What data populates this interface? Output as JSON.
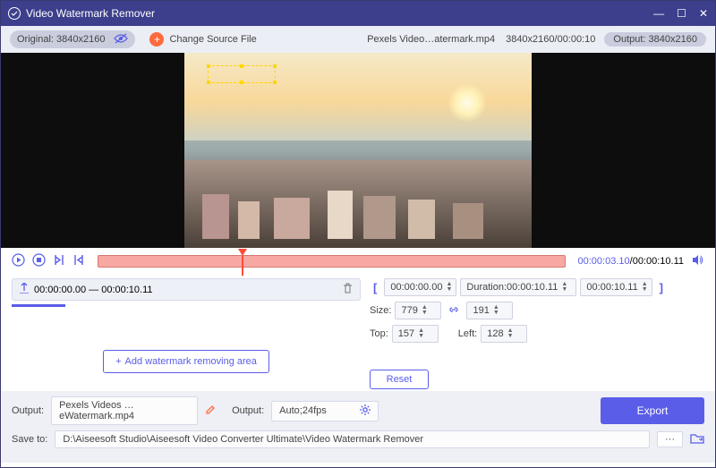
{
  "titlebar": {
    "title": "Video Watermark Remover"
  },
  "toolbar": {
    "original_label": "Original:",
    "original_res": "3840x2160",
    "change_source": "Change Source File",
    "filename": "Pexels Video…atermark.mp4",
    "file_meta": "3840x2160/00:00:10",
    "output_label": "Output:",
    "output_res": "3840x2160"
  },
  "playback": {
    "cur_time": "00:00:03.10",
    "total_time": "/00:00:10.11"
  },
  "segment": {
    "range": "00:00:00.00 — 00:00:10.11"
  },
  "range_panel": {
    "start": "00:00:00.00",
    "duration_label": "Duration:",
    "duration": "00:00:10.11",
    "end": "00:00:10.11",
    "size_label": "Size:",
    "size_w": "779",
    "size_h": "191",
    "top_label": "Top:",
    "top": "157",
    "left_label": "Left:",
    "left": "128"
  },
  "buttons": {
    "add_area": "Add watermark removing area",
    "reset": "Reset",
    "export": "Export"
  },
  "bottom": {
    "output_label": "Output:",
    "output_file": "Pexels Videos …eWatermark.mp4",
    "output2_label": "Output:",
    "output2_value": "Auto;24fps",
    "save_label": "Save to:",
    "save_path": "D:\\Aiseesoft Studio\\Aiseesoft Video Converter Ultimate\\Video Watermark Remover"
  }
}
